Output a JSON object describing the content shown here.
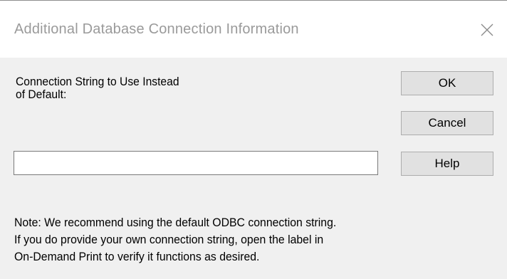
{
  "dialog": {
    "title": "Additional Database Connection Information",
    "close_icon": "close-icon"
  },
  "form": {
    "label_line1": "Connection String to Use Instead",
    "label_line2": "of Default:",
    "connection_string_value": "",
    "connection_string_placeholder": ""
  },
  "buttons": {
    "ok": "OK",
    "cancel": "Cancel",
    "help": "Help"
  },
  "note": {
    "line1": "Note:  We recommend using the default ODBC connection string.",
    "line2": "If you do provide your own connection string, open the label in",
    "line3": "On-Demand Print to verify it functions as desired."
  }
}
